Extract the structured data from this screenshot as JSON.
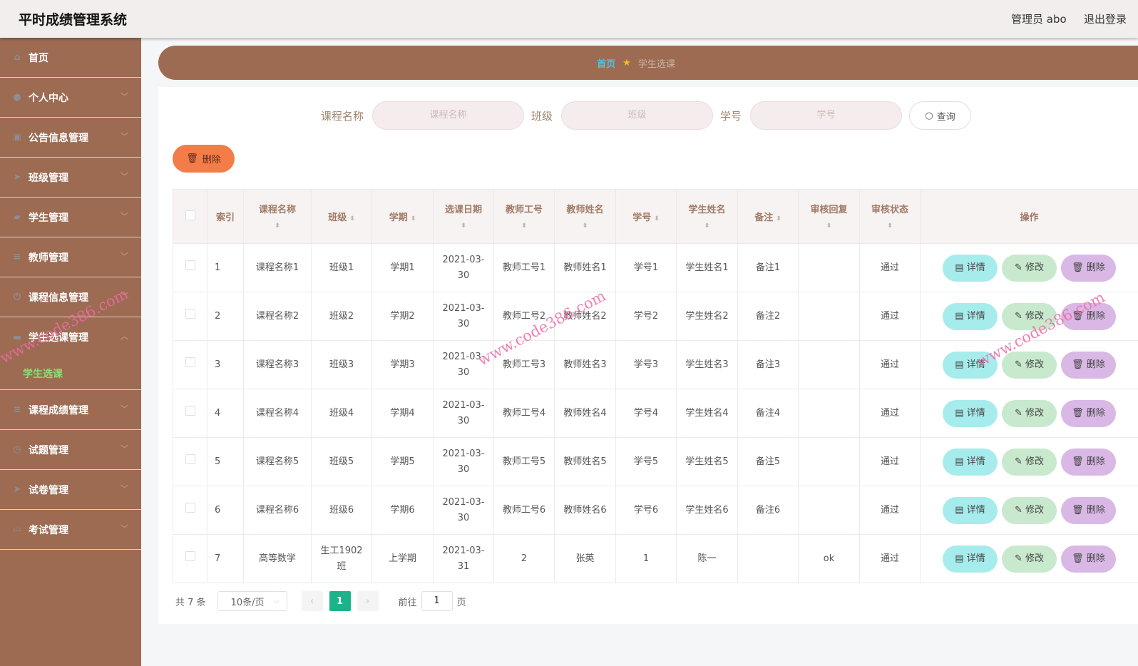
{
  "app": {
    "title": "平时成绩管理系统",
    "user": "管理员 abo",
    "logout": "退出登录"
  },
  "sidebar": {
    "items": [
      {
        "label": "首页",
        "icon": "home-icon"
      },
      {
        "label": "个人中心",
        "icon": "user-icon"
      },
      {
        "label": "公告信息管理",
        "icon": "clipboard-icon"
      },
      {
        "label": "班级管理",
        "icon": "send-icon"
      },
      {
        "label": "学生管理",
        "icon": "thumb-icon"
      },
      {
        "label": "教师管理",
        "icon": "list-icon"
      },
      {
        "label": "课程信息管理",
        "icon": "power-icon"
      },
      {
        "label": "学生选课管理",
        "icon": "monitor-icon",
        "sub": "学生选课"
      },
      {
        "label": "课程成绩管理",
        "icon": "list-icon"
      },
      {
        "label": "试题管理",
        "icon": "clock-icon"
      },
      {
        "label": "试卷管理",
        "icon": "send-icon"
      },
      {
        "label": "考试管理",
        "icon": "chat-icon"
      }
    ]
  },
  "breadcrumb": {
    "home": "首页",
    "current": "学生选课"
  },
  "search": {
    "course_label": "课程名称",
    "course_placeholder": "课程名称",
    "class_label": "班级",
    "class_placeholder": "班级",
    "sid_label": "学号",
    "sid_placeholder": "学号",
    "query": "查询"
  },
  "toolbar": {
    "delete": "删除"
  },
  "table": {
    "headers": [
      "索引",
      "课程名称",
      "班级",
      "学期",
      "选课日期",
      "教师工号",
      "教师姓名",
      "学号",
      "学生姓名",
      "备注",
      "审核回复",
      "审核状态",
      "操作"
    ],
    "rows": [
      [
        "1",
        "课程名称1",
        "班级1",
        "学期1",
        "2021-03-30",
        "教师工号1",
        "教师姓名1",
        "学号1",
        "学生姓名1",
        "备注1",
        "",
        "通过"
      ],
      [
        "2",
        "课程名称2",
        "班级2",
        "学期2",
        "2021-03-30",
        "教师工号2",
        "教师姓名2",
        "学号2",
        "学生姓名2",
        "备注2",
        "",
        "通过"
      ],
      [
        "3",
        "课程名称3",
        "班级3",
        "学期3",
        "2021-03-30",
        "教师工号3",
        "教师姓名3",
        "学号3",
        "学生姓名3",
        "备注3",
        "",
        "通过"
      ],
      [
        "4",
        "课程名称4",
        "班级4",
        "学期4",
        "2021-03-30",
        "教师工号4",
        "教师姓名4",
        "学号4",
        "学生姓名4",
        "备注4",
        "",
        "通过"
      ],
      [
        "5",
        "课程名称5",
        "班级5",
        "学期5",
        "2021-03-30",
        "教师工号5",
        "教师姓名5",
        "学号5",
        "学生姓名5",
        "备注5",
        "",
        "通过"
      ],
      [
        "6",
        "课程名称6",
        "班级6",
        "学期6",
        "2021-03-30",
        "教师工号6",
        "教师姓名6",
        "学号6",
        "学生姓名6",
        "备注6",
        "",
        "通过"
      ],
      [
        "7",
        "高等数学",
        "生工1902班",
        "上学期",
        "2021-03-31",
        "2",
        "张英",
        "1",
        "陈一",
        "",
        "ok",
        "通过"
      ]
    ],
    "actions": {
      "detail": "详情",
      "edit": "修改",
      "delete": "删除"
    }
  },
  "pagination": {
    "total": "共 7 条",
    "page_size": "10条/页",
    "current": "1",
    "goto_label": "前往",
    "goto_value": "1",
    "page_suffix": "页"
  },
  "watermark": "www.code386.com"
}
